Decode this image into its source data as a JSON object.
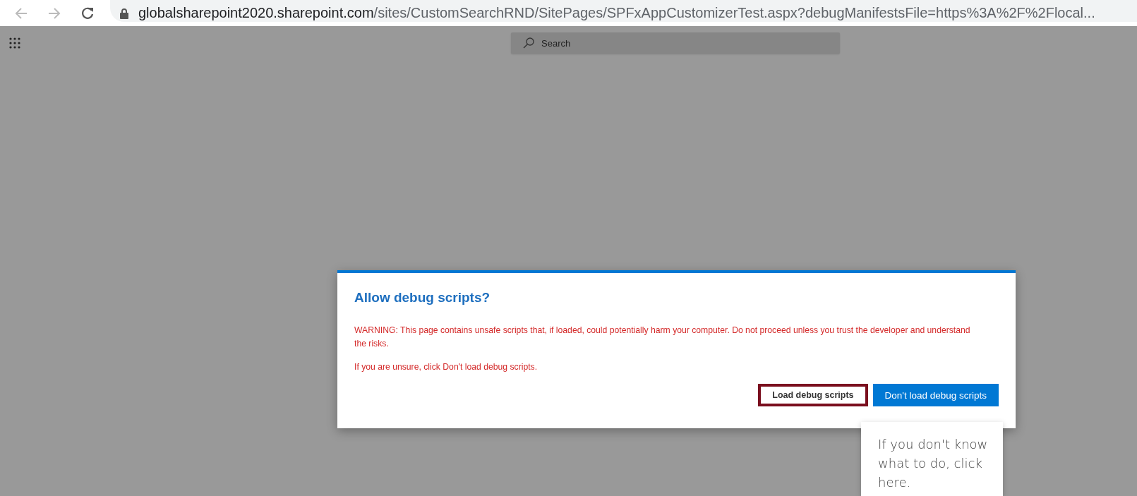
{
  "browser": {
    "url_host": "globalsharepoint2020.sharepoint.com",
    "url_path": "/sites/CustomSearchRND/SitePages/SPFxAppCustomizerTest.aspx?debugManifestsFile=https%3A%2F%2Flocal..."
  },
  "suite_bar": {
    "search": {
      "placeholder": "Search"
    }
  },
  "dialog": {
    "title": "Allow debug scripts?",
    "paragraphs": [
      "WARNING: This page contains unsafe scripts that, if loaded, could potentially harm your computer. Do not proceed unless you trust the developer and understand the risks.",
      "If you are unsure, click Don't load debug scripts."
    ],
    "buttons": [
      {
        "label": "Load debug scripts",
        "kind": "default",
        "focused": true
      },
      {
        "label": "Don't load debug scripts",
        "kind": "primary",
        "focused": false
      }
    ]
  },
  "callout": {
    "text": "If you don't know what to do, click here."
  }
}
